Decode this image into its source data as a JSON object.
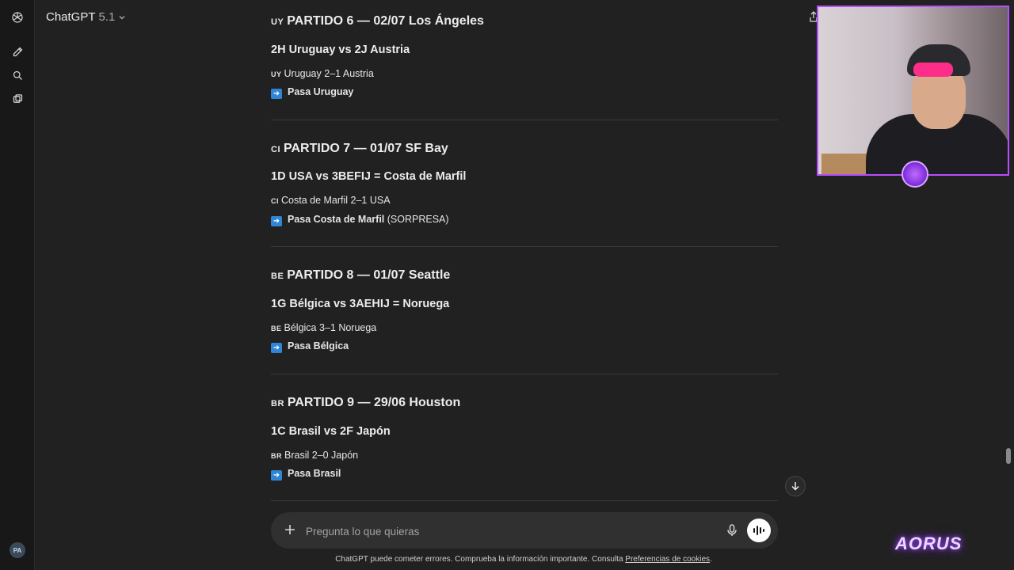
{
  "header": {
    "model_name": "ChatGPT",
    "model_version": "5.1"
  },
  "sidebar": {
    "avatar_initials": "PA"
  },
  "matches": [
    {
      "flag": "UY",
      "title": "PARTIDO 6 — 02/07 Los Ángeles",
      "matchup": "2H Uruguay vs 2J Austria",
      "result_flag": "UY",
      "result": "Uruguay 2–1 Austria",
      "advance_bold": "Pasa Uruguay",
      "advance_note": ""
    },
    {
      "flag": "CI",
      "title": "PARTIDO 7 — 01/07 SF Bay",
      "matchup": "1D USA vs 3BEFIJ = Costa de Marfil",
      "result_flag": "CI",
      "result": "Costa de Marfil 2–1 USA",
      "advance_bold": "Pasa Costa de Marfil",
      "advance_note": " (SORPRESA)"
    },
    {
      "flag": "BE",
      "title": "PARTIDO 8 — 01/07 Seattle",
      "matchup": "1G Bélgica vs 3AEHIJ = Noruega",
      "result_flag": "BE",
      "result": "Bélgica 3–1 Noruega",
      "advance_bold": "Pasa Bélgica",
      "advance_note": ""
    },
    {
      "flag": "BR",
      "title": "PARTIDO 9 — 29/06 Houston",
      "matchup": "1C Brasil vs 2F Japón",
      "result_flag": "BR",
      "result": "Brasil 2–0 Japón",
      "advance_bold": "Pasa Brasil",
      "advance_note": ""
    }
  ],
  "composer": {
    "placeholder": "Pregunta lo que quieras"
  },
  "footer": {
    "disclaimer": "ChatGPT puede cometer errores. Comprueba la información importante. Consulta ",
    "link": "Preferencias de cookies",
    "end": "."
  },
  "overlay": {
    "brand_logo": "AORUS"
  },
  "icons": {
    "logo": "openai-logo-icon",
    "new_chat": "new-chat-icon",
    "search": "search-icon",
    "library": "library-icon",
    "plus": "plus-icon",
    "mic": "microphone-icon",
    "voice": "voice-mode-icon",
    "scroll_down": "arrow-down-icon",
    "advance": "right-arrow-emoji-icon"
  },
  "colors": {
    "background": "#212121",
    "sidebar": "#181818",
    "composer": "#303030",
    "overlay_border": "#b64dff",
    "arrow_emoji": "#2f86d6"
  }
}
